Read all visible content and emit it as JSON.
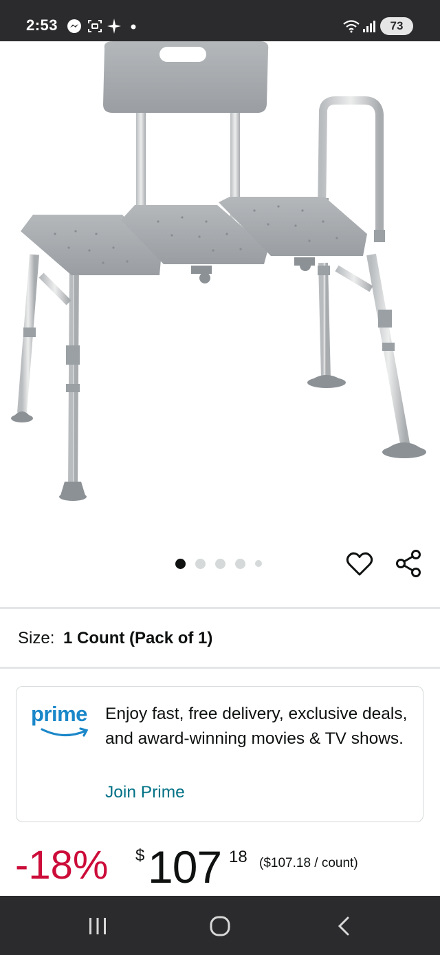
{
  "status_bar": {
    "time": "2:53",
    "battery": "73",
    "icons": [
      "messenger-icon",
      "screenshot-icon",
      "sparkle-icon",
      "dot-icon",
      "wifi-icon",
      "signal-icon"
    ]
  },
  "product": {
    "image_alt": "Transfer bench with backrest and side handle",
    "carousel": {
      "total": 5,
      "active_index": 0
    }
  },
  "size": {
    "label": "Size:",
    "value": "1 Count (Pack of 1)"
  },
  "prime": {
    "logo_text": "prime",
    "message": "Enjoy fast, free delivery, exclusive deals, and award-winning movies & TV shows.",
    "link": "Join Prime"
  },
  "price": {
    "discount": "-18%",
    "currency": "$",
    "whole": "107",
    "fraction": "18",
    "unit_price": "($107.18 / count)"
  },
  "colors": {
    "discount": "#cc0c39",
    "link": "#007185",
    "prime_blue": "#1a87c9",
    "system_bar": "#2b2b2e"
  }
}
